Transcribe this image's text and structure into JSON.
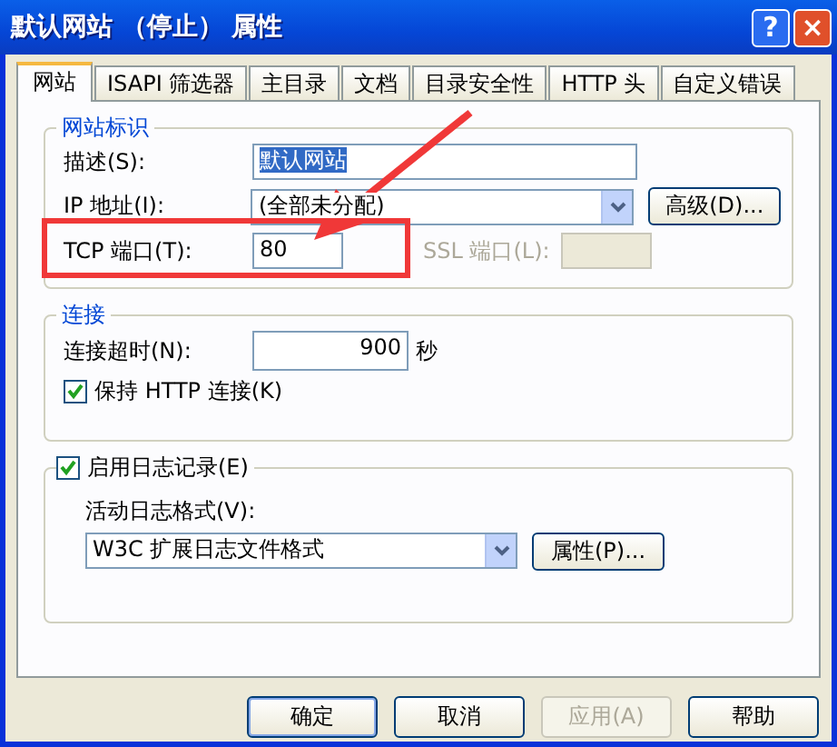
{
  "window": {
    "title": "默认网站 （停止） 属性",
    "help_button": "?",
    "close_button": "×"
  },
  "tabs": [
    {
      "label": "网站",
      "selected": true
    },
    {
      "label": "ISAPI 筛选器",
      "selected": false
    },
    {
      "label": "主目录",
      "selected": false
    },
    {
      "label": "文档",
      "selected": false
    },
    {
      "label": "目录安全性",
      "selected": false
    },
    {
      "label": "HTTP 头",
      "selected": false
    },
    {
      "label": "自定义错误",
      "selected": false
    }
  ],
  "site_identity": {
    "title": "网站标识",
    "description": {
      "label": "描述(S):",
      "value": "默认网站",
      "selected": true
    },
    "ip": {
      "label": "IP 地址(I):",
      "value": "(全部未分配)",
      "button": "高级(D)..."
    },
    "tcp_port": {
      "label": "TCP 端口(T):",
      "value": "80"
    },
    "ssl_port": {
      "label": "SSL 端口(L):",
      "disabled": true
    }
  },
  "connection": {
    "title": "连接",
    "timeout": {
      "label": "连接超时(N):",
      "value": "900",
      "unit": "秒"
    },
    "keep_alive": {
      "label": "保持 HTTP 连接(K)",
      "checked": true
    }
  },
  "logging": {
    "label": "启用日志记录(E)",
    "checked": true,
    "format_label": "活动日志格式(V):",
    "format": "W3C 扩展日志文件格式",
    "button": "属性(P)..."
  },
  "buttons": [
    {
      "label": "确定",
      "disabled": false,
      "selected": true
    },
    {
      "label": "取消",
      "disabled": false,
      "selected": false
    },
    {
      "label": "应用(A)",
      "disabled": true,
      "selected": false
    },
    {
      "label": "帮助",
      "disabled": false,
      "selected": false
    }
  ]
}
